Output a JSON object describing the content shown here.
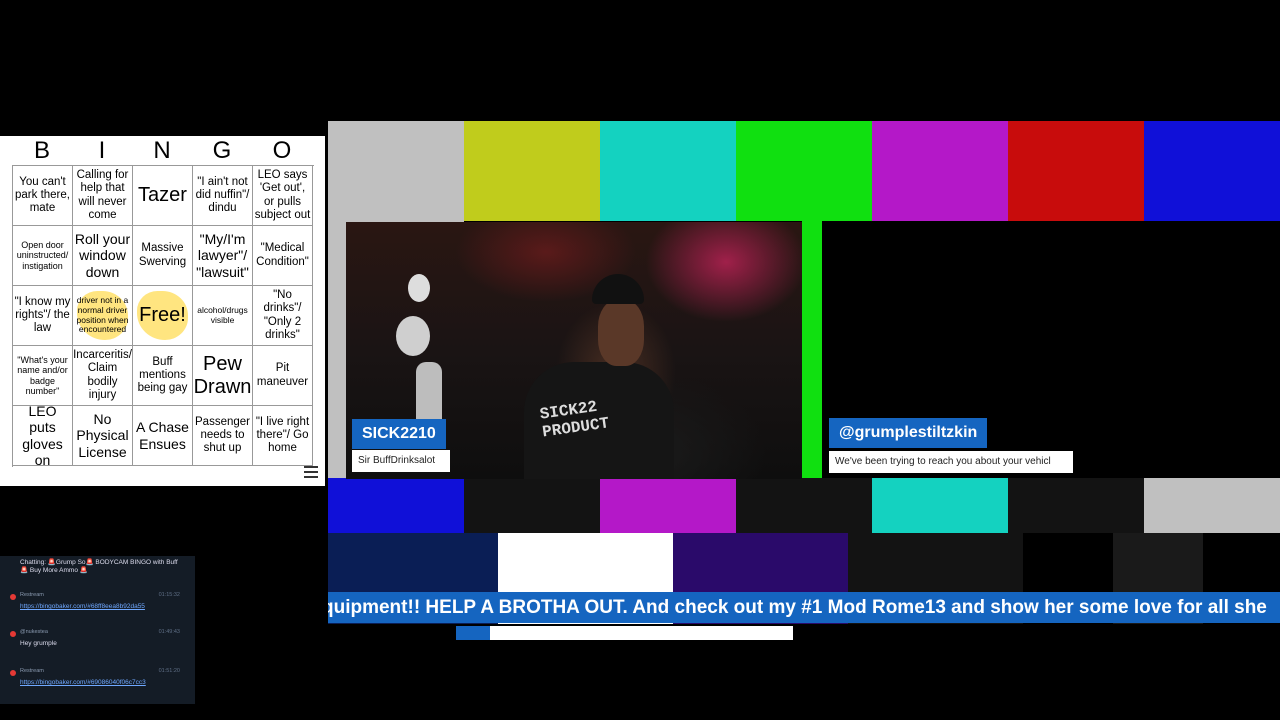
{
  "bingo": {
    "letters": [
      "B",
      "I",
      "N",
      "G",
      "O"
    ],
    "cells": [
      [
        {
          "text": "You can't park there, mate",
          "size": "normal"
        },
        {
          "text": "Calling for help that will never come",
          "size": "normal"
        },
        {
          "text": "Tazer",
          "size": "big"
        },
        {
          "text": "\"I ain't not did nuffin\"/ dindu",
          "size": "normal"
        },
        {
          "text": "LEO says 'Get out', or pulls subject out",
          "size": "normal"
        }
      ],
      [
        {
          "text": "Open door uninstructed/ instigation",
          "size": "small"
        },
        {
          "text": "Roll your window down",
          "size": "med"
        },
        {
          "text": "Massive Swerving",
          "size": "normal"
        },
        {
          "text": "\"My/I'm lawyer\"/ \"lawsuit\"",
          "size": "med"
        },
        {
          "text": "\"Medical Condition\"",
          "size": "normal"
        }
      ],
      [
        {
          "text": "\"I know my rights\"/ the law",
          "size": "normal"
        },
        {
          "text": "driver not in a normal driver position when encountered",
          "size": "tiny",
          "highlight": true
        },
        {
          "text": "Free!",
          "size": "big",
          "highlight": true
        },
        {
          "text": "alcohol/drugs visible",
          "size": "tiny"
        },
        {
          "text": "\"No drinks\"/ \"Only 2 drinks\"",
          "size": "normal"
        }
      ],
      [
        {
          "text": "\"What's your name and/or badge number\"",
          "size": "small"
        },
        {
          "text": "Incarceritis/ Claim bodily injury",
          "size": "normal"
        },
        {
          "text": "Buff mentions being gay",
          "size": "normal"
        },
        {
          "text": "Pew Drawn",
          "size": "big"
        },
        {
          "text": "Pit maneuver",
          "size": "normal"
        }
      ],
      [
        {
          "text": "LEO puts gloves on",
          "size": "med"
        },
        {
          "text": "No Physical License",
          "size": "med"
        },
        {
          "text": "A Chase Ensues",
          "size": "med"
        },
        {
          "text": "Passenger needs to shut up",
          "size": "normal"
        },
        {
          "text": "\"I live right there\"/ Go home",
          "size": "normal"
        }
      ]
    ]
  },
  "webcam": {
    "name": "SICK2210",
    "subtitle": "Sir BuffDrinksalot",
    "shirt_text": "SICK22\nPRODUCT"
  },
  "guest": {
    "name": "@grumplestiltzkin",
    "subtitle": "We've been trying to reach you about your vehicl"
  },
  "ticker": {
    "text": "quipment!! HELP A BROTHA OUT. And check out my #1 Mod Rome13 and show her some love for all she",
    "progress": 0.1
  },
  "chat": {
    "messages": [
      {
        "user": "",
        "time": "",
        "body": "Chatting: 🚨Grump So🚨 BODYCAM BINGO with Buff 🚨 Buy More Ammo 🚨",
        "link": false
      },
      {
        "user": "Restream",
        "time": "01:15:32",
        "body": "https://bingobaker.com/#68ff8eea8b92da55",
        "link": true
      },
      {
        "user": "@nukestea",
        "time": "01:49:43",
        "body": "Hey grumple",
        "link": false
      },
      {
        "user": "Restream",
        "time": "01:51:20",
        "body": "https://bingobaker.com/#69086040f06c7cc3",
        "link": true
      }
    ]
  },
  "colors": {
    "accent_blue": "#1565c0",
    "bars_top": [
      "#c0c0c0",
      "#c0cc1c",
      "#14d2c0",
      "#10e010",
      "#b418c8",
      "#c80c0c",
      "#1010d8"
    ],
    "bars_mid": [
      "#1010d8",
      "#131313",
      "#b418c8",
      "#131313",
      "#14d2c0",
      "#131313",
      "#c0c0c0"
    ],
    "bars_bottom": [
      "#0a1e55",
      "#ffffff",
      "#2a0a6a",
      "#131313",
      "#000000",
      "#1a1a1a",
      "#000000"
    ]
  }
}
